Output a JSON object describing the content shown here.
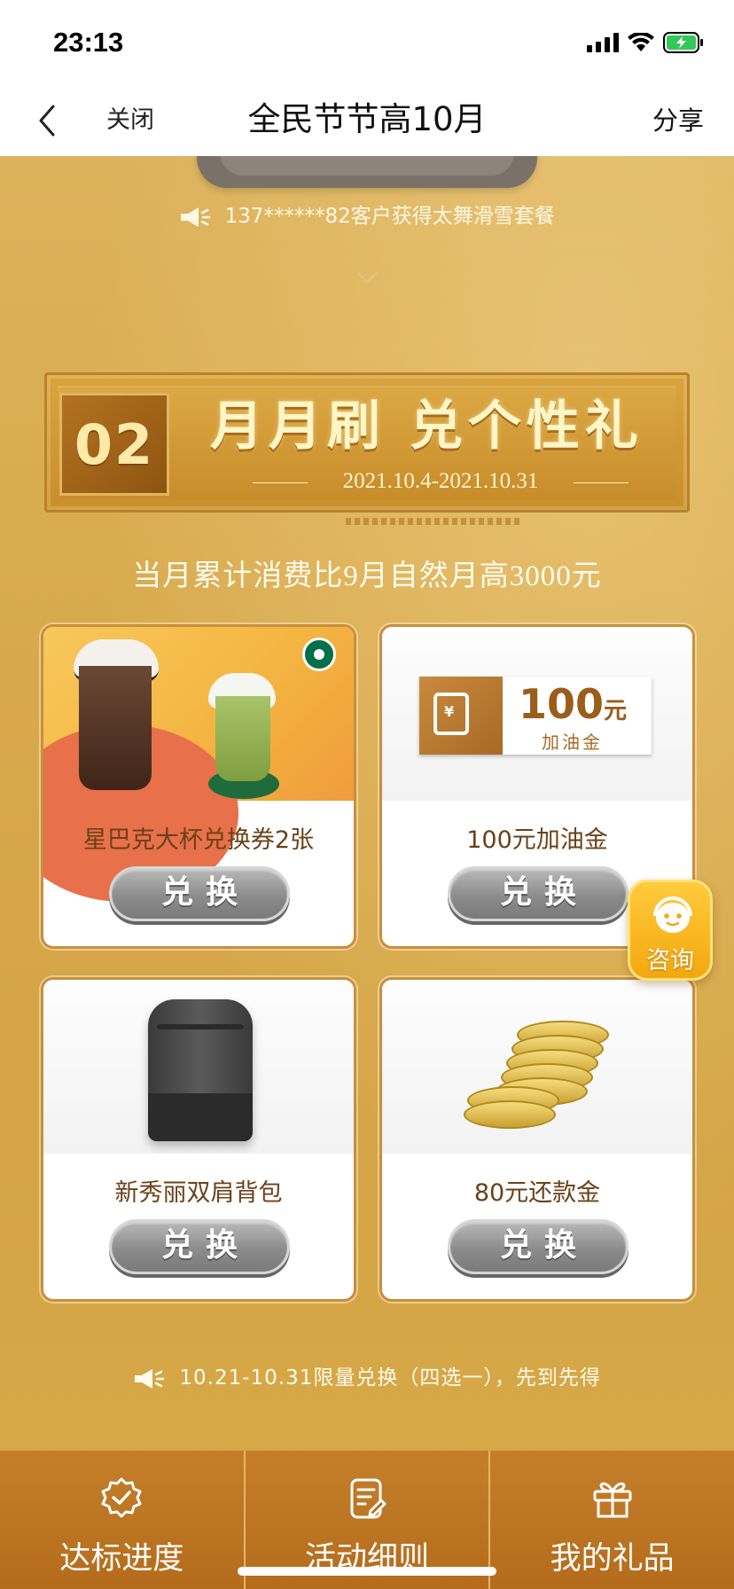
{
  "status_bar": {
    "time": "23:13"
  },
  "nav": {
    "close_label": "关闭",
    "title": "全民节节高10月",
    "share_label": "分享"
  },
  "announcement": "137******82客户获得太舞滑雪套餐",
  "section": {
    "number": "02",
    "title": "月月刷 兑个性礼",
    "dates": "2021.10.4-2021.10.31"
  },
  "condition": "当月累计消费比9月自然月高3000元",
  "gifts": [
    {
      "name": "星巴克大杯兑换券2张",
      "button_label": "兑换",
      "image": "starbucks-cups"
    },
    {
      "name": "100元加油金",
      "button_label": "兑换",
      "image": "fuel-voucher",
      "voucher": {
        "amount": "100",
        "unit": "元",
        "label": "加油金"
      }
    },
    {
      "name": "新秀丽双肩背包",
      "button_label": "兑换",
      "image": "backpack"
    },
    {
      "name": "80元还款金",
      "button_label": "兑换",
      "image": "gold-coins"
    }
  ],
  "consult": {
    "label": "咨询",
    "icon": "headset-icon"
  },
  "limit_note": "10.21-10.31限量兑换（四选一），先到先得",
  "tabs": [
    {
      "label": "达标进度",
      "icon": "badge-check-icon"
    },
    {
      "label": "活动细则",
      "icon": "document-edit-icon"
    },
    {
      "label": "我的礼品",
      "icon": "gift-icon"
    }
  ],
  "colors": {
    "background_gold": "#d8a94c",
    "tab_bar": "#c57f2a",
    "gift_name": "#6b4119",
    "button_gray": "#8c8c8c",
    "consult_yellow": "#f4a70e"
  }
}
